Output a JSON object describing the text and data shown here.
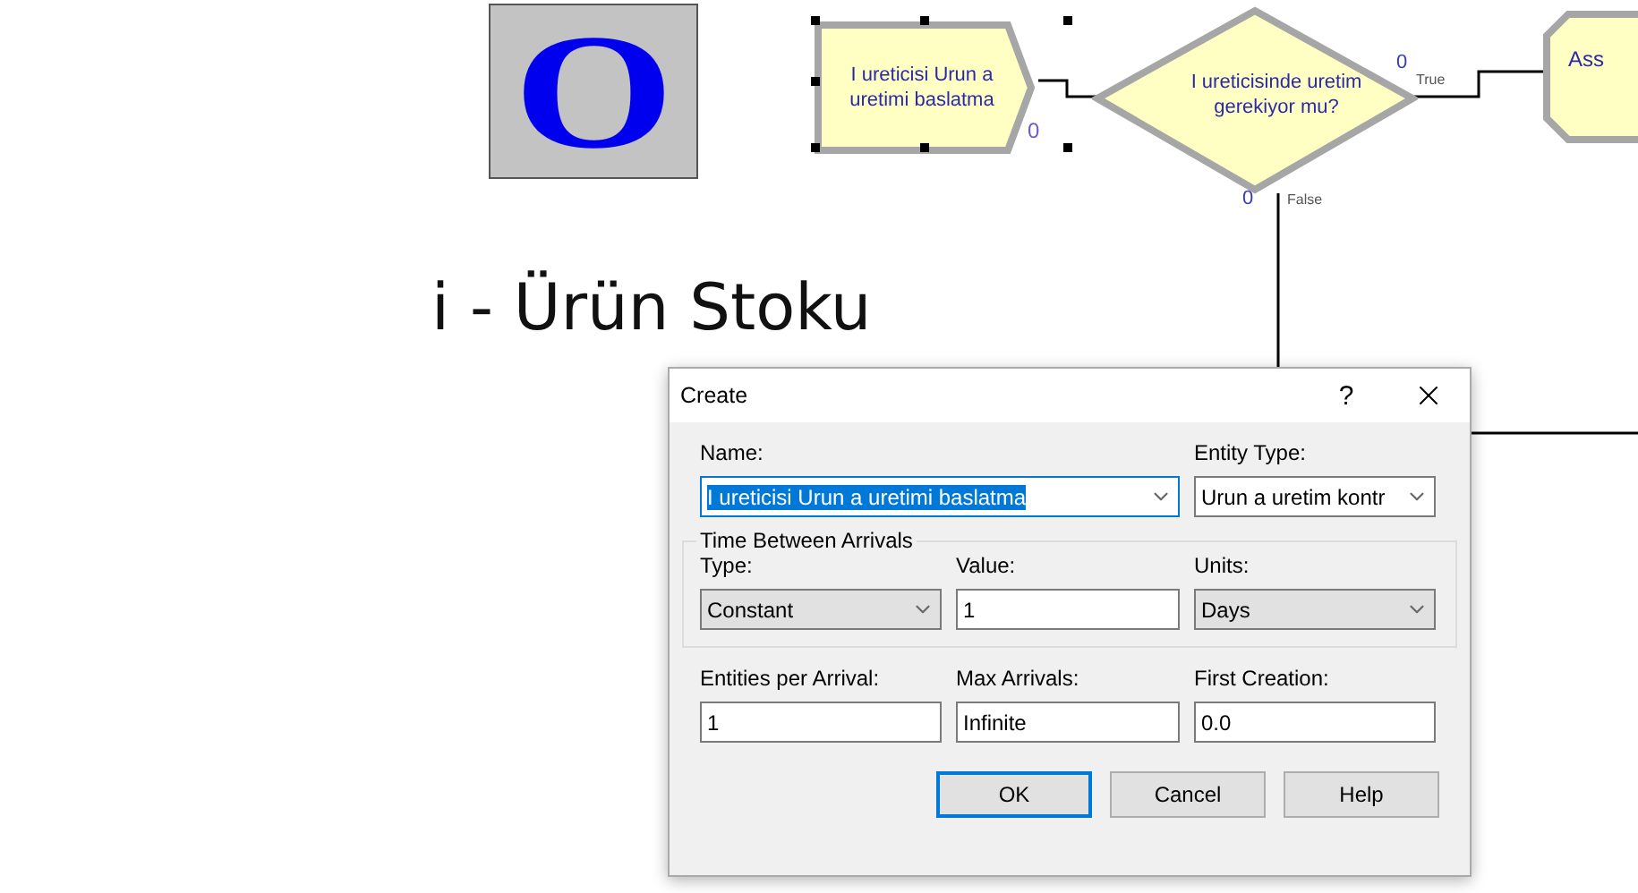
{
  "canvas": {
    "logo": {
      "letter": "O"
    },
    "heading": "i - Ürün Stoku",
    "nodes": [
      {
        "kind": "create",
        "label": "I ureticisi Urun a uretimi baslatma",
        "count": "0",
        "selected": true
      },
      {
        "kind": "decide",
        "label": "I ureticisinde uretim gerekiyor mu?",
        "true_count": "0",
        "true_label": "True",
        "false_count": "0",
        "false_label": "False",
        "selected": false
      },
      {
        "kind": "assign",
        "label": "Ass",
        "selected": false
      }
    ]
  },
  "dialog": {
    "title": "Create",
    "help": "?",
    "rows": [
      [
        {
          "label": "Name:",
          "kind": "combo-edit",
          "value": "I ureticisi Urun a uretimi baslatma",
          "highlighted": true
        },
        {
          "label": "Entity Type:",
          "kind": "combo-edit",
          "value": "Urun a uretim kontr",
          "highlighted": false
        }
      ]
    ],
    "group": {
      "title": "Time Between Arrivals",
      "fields": [
        {
          "label": "Type:",
          "kind": "combo-list",
          "value": "Constant",
          "highlighted": false
        },
        {
          "label": "Value:",
          "kind": "text",
          "value": "1",
          "highlighted": false
        },
        {
          "label": "Units:",
          "kind": "combo-list",
          "value": "Days",
          "highlighted": false
        }
      ]
    },
    "bottom_fields": [
      {
        "label": "Entities per Arrival:",
        "kind": "text",
        "value": "1",
        "highlighted": false
      },
      {
        "label": "Max Arrivals:",
        "kind": "text",
        "value": "Infinite",
        "highlighted": false
      },
      {
        "label": "First Creation:",
        "kind": "text",
        "value": "0.0",
        "highlighted": false
      }
    ],
    "buttons": [
      {
        "label": "OK",
        "default": true
      },
      {
        "label": "Cancel",
        "default": false
      },
      {
        "label": "Help",
        "default": false
      }
    ]
  }
}
